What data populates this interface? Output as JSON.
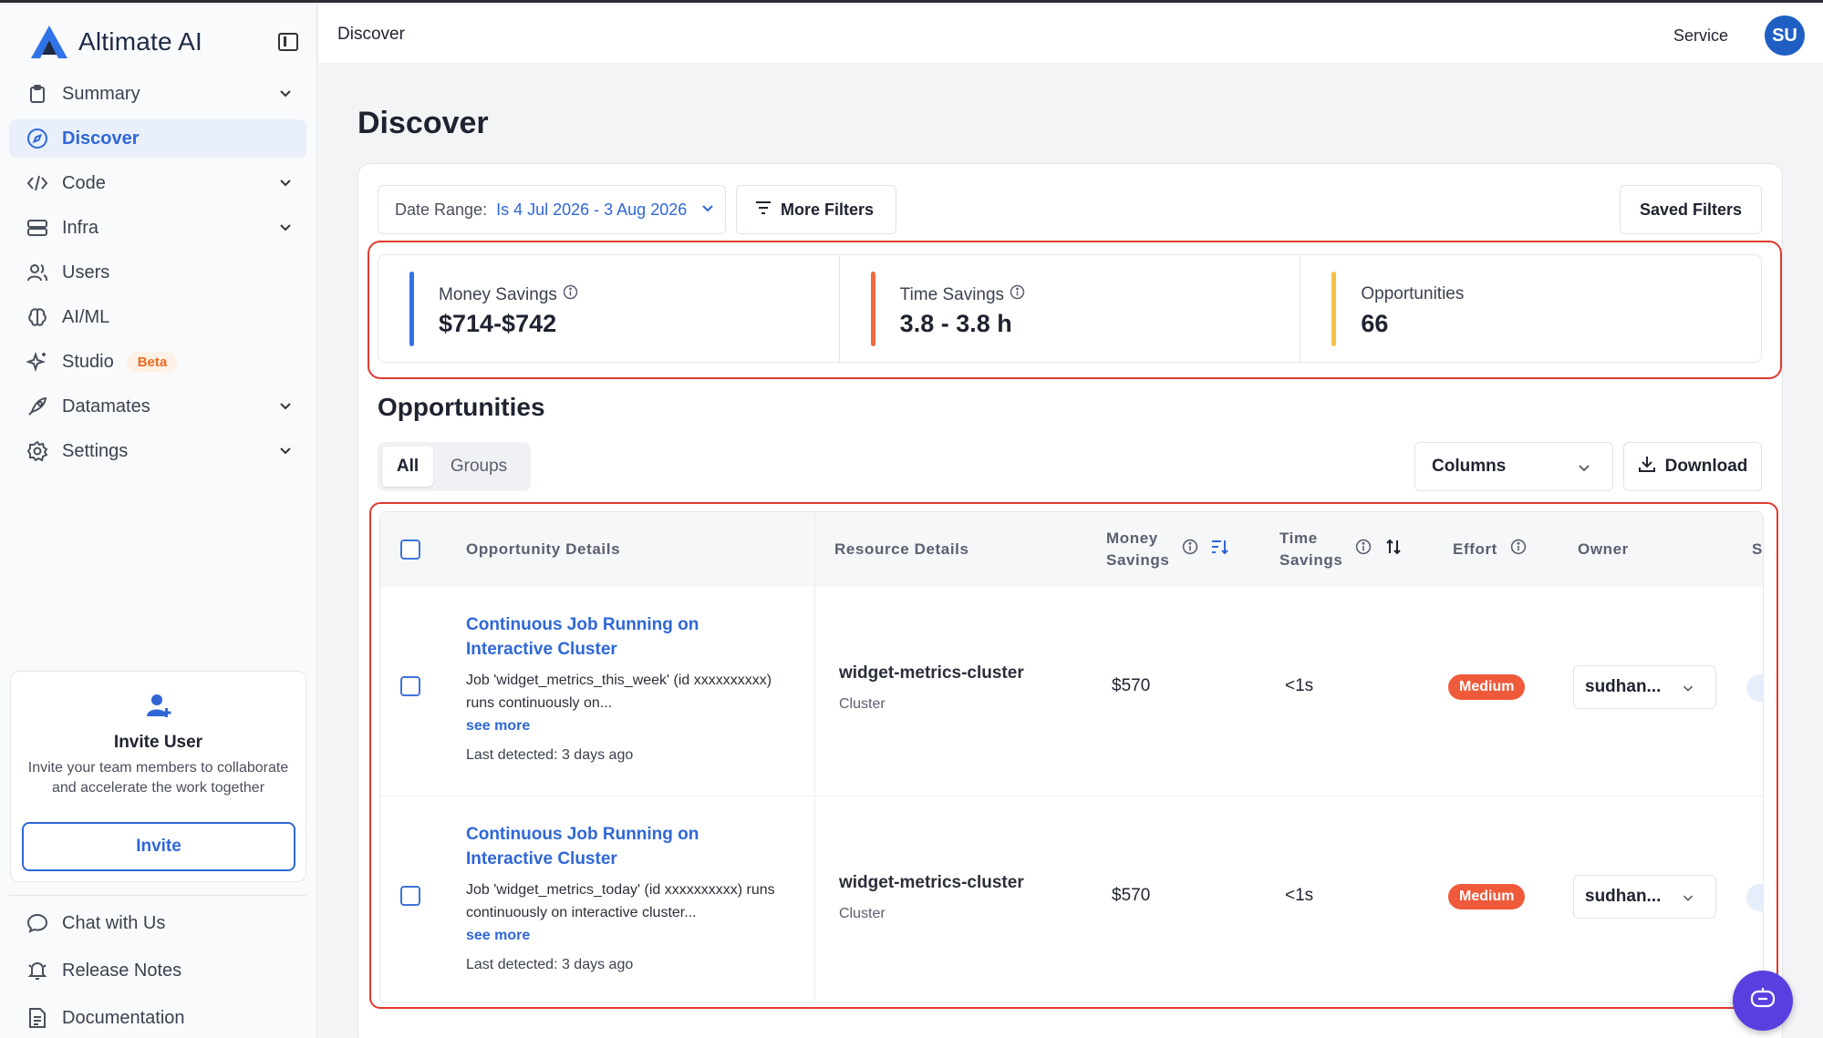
{
  "app": {
    "name": "Altimate AI"
  },
  "sidebar": {
    "items": [
      {
        "label": "Summary",
        "icon": "clipboard-icon",
        "expandable": true
      },
      {
        "label": "Discover",
        "icon": "compass-icon",
        "active": true
      },
      {
        "label": "Code",
        "icon": "code-icon",
        "expandable": true
      },
      {
        "label": "Infra",
        "icon": "database-icon",
        "expandable": true
      },
      {
        "label": "Users",
        "icon": "users-icon"
      },
      {
        "label": "AI/ML",
        "icon": "brain-icon"
      },
      {
        "label": "Studio",
        "icon": "sparkles-icon",
        "badge": "Beta"
      },
      {
        "label": "Datamates",
        "icon": "rocket-icon",
        "expandable": true
      },
      {
        "label": "Settings",
        "icon": "gear-icon",
        "expandable": true
      }
    ],
    "invite": {
      "title": "Invite User",
      "description": "Invite your team members to collaborate and accelerate the work together",
      "button": "Invite"
    },
    "bottom": [
      {
        "label": "Chat with Us",
        "icon": "chat-icon"
      },
      {
        "label": "Release Notes",
        "icon": "bell-icon"
      },
      {
        "label": "Documentation",
        "icon": "document-icon"
      }
    ]
  },
  "header": {
    "title": "Discover",
    "user_name": "Service",
    "avatar_initials": "SU"
  },
  "main": {
    "title": "Discover",
    "filters": {
      "date_label": "Date Range:",
      "date_value": "Is 4 Jul 2026 - 3 Aug 2026",
      "more_filters": "More Filters",
      "saved_filters": "Saved Filters"
    },
    "stats": [
      {
        "label": "Money Savings",
        "value": "$714-$742",
        "color": "#2f73e8",
        "info": true
      },
      {
        "label": "Time Savings",
        "value": "3.8 - 3.8 h",
        "color": "#f26a3d",
        "info": true
      },
      {
        "label": "Opportunities",
        "value": "66",
        "color": "#f5c04a",
        "info": false
      }
    ],
    "section_title": "Opportunities",
    "tabs": [
      {
        "label": "All",
        "active": true
      },
      {
        "label": "Groups"
      }
    ],
    "columns_label": "Columns",
    "download_label": "Download",
    "table": {
      "headers": {
        "details": "Opportunity Details",
        "resource": "Resource Details",
        "money_1": "Money",
        "money_2": "Savings",
        "time_1": "Time",
        "time_2": "Savings",
        "effort": "Effort",
        "owner": "Owner",
        "next": "S"
      },
      "rows": [
        {
          "title": "Continuous Job Running on Interactive Cluster",
          "description": "Job 'widget_metrics_this_week' (id xxxxxxxxxx) runs continuously on...",
          "see_more": "see more",
          "detected": "Last detected: 3 days ago",
          "resource_name": "widget-metrics-cluster",
          "resource_type": "Cluster",
          "money": "$570",
          "time": "<1s",
          "effort": "Medium",
          "owner": "sudhan..."
        },
        {
          "title": "Continuous Job Running on Interactive Cluster",
          "description": "Job 'widget_metrics_today' (id xxxxxxxxxx) runs continuously on interactive cluster...",
          "see_more": "see more",
          "detected": "Last detected: 3 days ago",
          "resource_name": "widget-metrics-cluster",
          "resource_type": "Cluster",
          "money": "$570",
          "time": "<1s",
          "effort": "Medium",
          "owner": "sudhan..."
        }
      ]
    }
  },
  "colors": {
    "accent": "#2f67d6",
    "highlight_outline": "#e03a2e",
    "effort_medium": "#ef5a3a",
    "chat_fab": "#5a3fe0"
  }
}
